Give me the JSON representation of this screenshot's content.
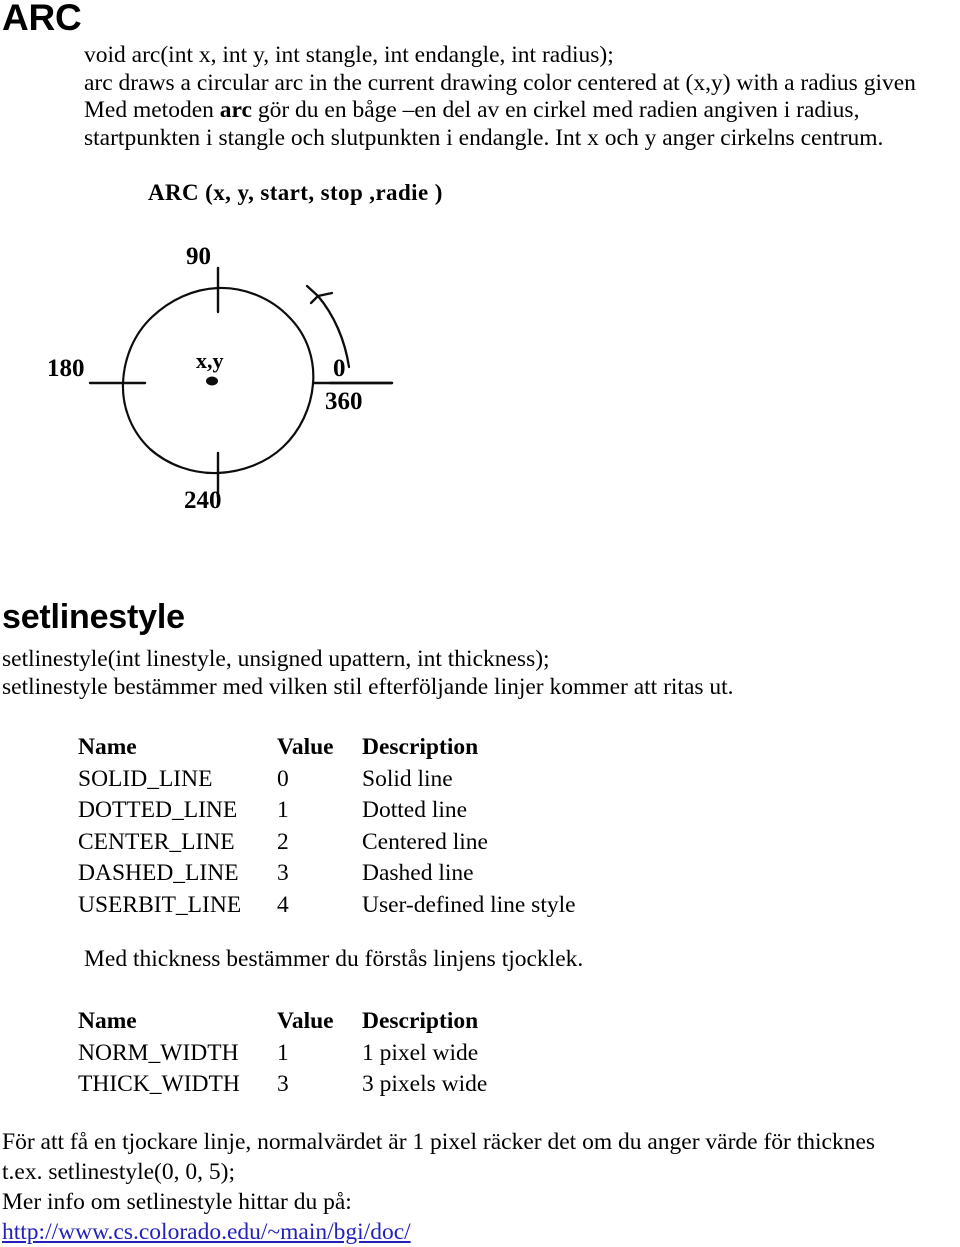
{
  "document": {
    "sections": [
      {
        "heading": "ARC"
      },
      {
        "heading": "setlinestyle"
      }
    ]
  },
  "arc_section": {
    "heading": "ARC",
    "signature": "void arc(int x, int y, int stangle, int endangle, int radius);",
    "english_description": "arc draws a circular arc in the current drawing color centered at (x,y) with a radius given",
    "swedish_line_1_prefix": "Med metoden ",
    "swedish_line_1_bold": "arc",
    "swedish_line_1_suffix": " gör du en båge –en del av en cirkel med radien angiven i radius,",
    "swedish_line_2": "startpunkten i stangle och slutpunkten i endangle. Int x och y anger cirkelns centrum."
  },
  "diagram": {
    "title": "ARC (x, y, start, stop ,radie )",
    "center_label": "x,y",
    "angle_labels": {
      "top": "90",
      "left": "180",
      "right_top": "0",
      "right_bottom": "360",
      "bottom": "240"
    },
    "direction": "counterclockwise",
    "ticks": [
      {
        "name": "tick-90",
        "angle_deg": 90
      },
      {
        "name": "tick-180",
        "angle_deg": 180
      },
      {
        "name": "tick-0-360",
        "angle_deg": 0
      },
      {
        "name": "tick-240",
        "angle_deg": 270
      }
    ],
    "stroke_color": "#000000"
  },
  "setlinestyle_section": {
    "heading": "setlinestyle",
    "signature": "setlinestyle(int linestyle, unsigned upattern, int thickness);",
    "description": "setlinestyle bestämmer med vilken stil efterföljande linjer kommer att ritas ut.",
    "thickness_note": "Med thickness bestämmer du förstås linjens tjocklek."
  },
  "linestyle_table": {
    "name": "linestyle-constants-table",
    "headers": [
      "Name",
      "Value",
      "Description"
    ],
    "rows": [
      {
        "name": "SOLID_LINE",
        "value": "0",
        "description": "Solid line"
      },
      {
        "name": "DOTTED_LINE",
        "value": "1",
        "description": "Dotted line"
      },
      {
        "name": "CENTER_LINE",
        "value": "2",
        "description": "Centered line"
      },
      {
        "name": "DASHED_LINE",
        "value": "3",
        "description": "Dashed line"
      },
      {
        "name": "USERBIT_LINE",
        "value": "4",
        "description": "User-defined line style"
      }
    ]
  },
  "width_table": {
    "name": "width-constants-table",
    "headers": [
      "Name",
      "Value",
      "Description"
    ],
    "rows": [
      {
        "name": "NORM_WIDTH",
        "value": "1",
        "description": "1 pixel wide"
      },
      {
        "name": "THICK_WIDTH",
        "value": "3",
        "description": "3 pixels wide"
      }
    ]
  },
  "closing_note": {
    "line_1": "För att få en tjockare linje, normalvärdet är 1 pixel räcker det om du anger värde för thicknes",
    "line_2": "t.ex. setlinestyle(0, 0, 5);",
    "line_3": "Mer info om setlinestyle hittar du på:",
    "link_text": "http://www.cs.colorado.edu/~main/bgi/doc/",
    "link_color": "#2222bb"
  }
}
